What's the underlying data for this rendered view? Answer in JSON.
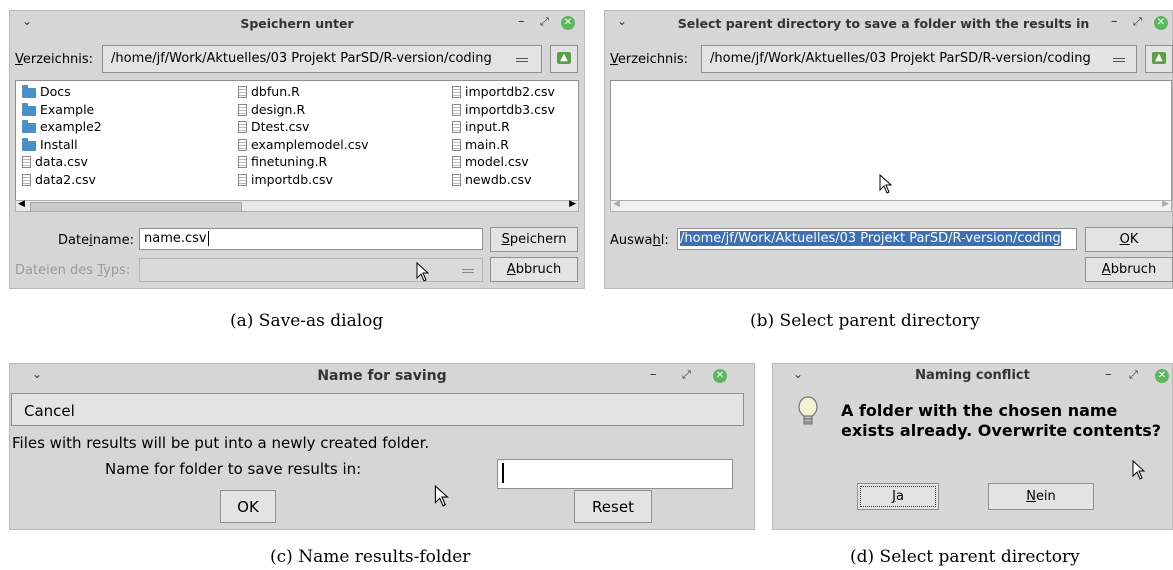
{
  "dialog_a": {
    "title": "Speichern unter",
    "dir_label": "Verzeichnis:",
    "dir_path": "/home/jf/Work/Aktuelles/03 Projekt ParSD/R-version/coding",
    "files": [
      {
        "name": "Docs",
        "kind": "folder"
      },
      {
        "name": "Example",
        "kind": "folder"
      },
      {
        "name": "example2",
        "kind": "folder"
      },
      {
        "name": "Install",
        "kind": "folder"
      },
      {
        "name": "data.csv",
        "kind": "file"
      },
      {
        "name": "data2.csv",
        "kind": "file"
      },
      {
        "name": "dbfun.R",
        "kind": "file"
      },
      {
        "name": "design.R",
        "kind": "file"
      },
      {
        "name": "Dtest.csv",
        "kind": "file"
      },
      {
        "name": "examplemodel.csv",
        "kind": "file"
      },
      {
        "name": "finetuning.R",
        "kind": "file"
      },
      {
        "name": "importdb.csv",
        "kind": "file"
      },
      {
        "name": "importdb2.csv",
        "kind": "file"
      },
      {
        "name": "importdb3.csv",
        "kind": "file"
      },
      {
        "name": "input.R",
        "kind": "file"
      },
      {
        "name": "main.R",
        "kind": "file"
      },
      {
        "name": "model.csv",
        "kind": "file"
      },
      {
        "name": "newdb.csv",
        "kind": "file"
      }
    ],
    "filename_label": "Dateiname:",
    "filename_value": "name.csv",
    "filetype_label": "Dateien des Typs:",
    "save_button": "Speichern",
    "cancel_button": "Abbruch",
    "caption": "(a) Save-as dialog"
  },
  "dialog_b": {
    "title": "Select parent directory to save a folder with the results in",
    "dir_label": "Verzeichnis:",
    "dir_path": "/home/jf/Work/Aktuelles/03 Projekt ParSD/R-version/coding",
    "selection_label": "Auswahl:",
    "selection_value": "/home/jf/Work/Aktuelles/03 Projekt ParSD/R-version/coding",
    "ok_button": "OK",
    "cancel_button": "Abbruch",
    "caption": "(b) Select parent directory"
  },
  "dialog_c": {
    "title": "Name for saving",
    "cancel_bar": "Cancel",
    "info_text": "Files with results will be put into a newly created folder.",
    "name_label": "Name for folder to save results in:",
    "name_value": "",
    "ok_button": "OK",
    "reset_button": "Reset",
    "caption": "(c) Name results-folder"
  },
  "dialog_d": {
    "title": "Naming conflict",
    "message": "A folder with the chosen name exists already. Overwrite contents?",
    "yes_button": "Ja",
    "no_button": "Nein",
    "caption": "(d) Select parent directory"
  },
  "titlebar_controls": {
    "menu": "⌄",
    "minimize": "–",
    "maximize": "⤢",
    "close": "✕"
  },
  "colors": {
    "window_bg": "#d6d6d6",
    "close_green": "#5cb85c",
    "folder_blue": "#4a90c8",
    "selection_bg": "#3d6fb3"
  }
}
